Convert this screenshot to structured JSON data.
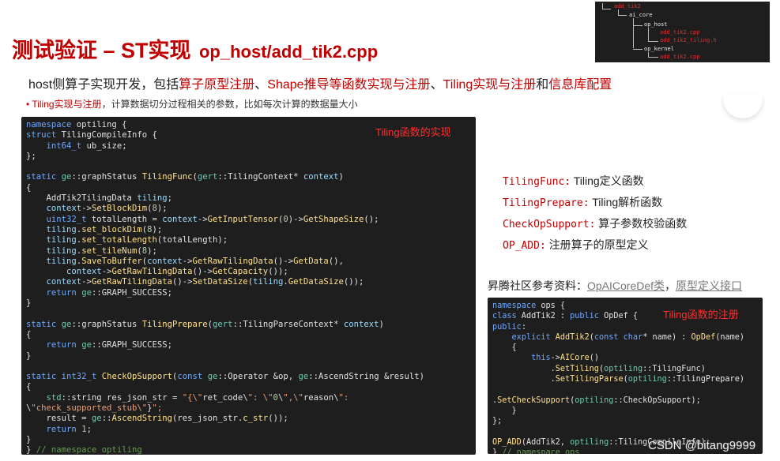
{
  "title": {
    "main": "测试验证 – ST实现",
    "path": "op_host/add_tik2.cpp"
  },
  "tree": {
    "root": "add_tik2",
    "core": "ai_core",
    "host": "op_host",
    "host_files": [
      "add_tik2.cpp",
      "add_tik2_tiling.h"
    ],
    "kernel": "op_kernel",
    "kernel_files": [
      "add_tik2.cpp"
    ]
  },
  "subtitle": {
    "prefix": "host侧算子实现开发，包括",
    "p1": "算子原型注册",
    "sep1": "、",
    "p2": "Shape推导等函数实现与注册",
    "sep2": "、",
    "p3": "Tiling实现与注册",
    "mid": "和",
    "p4": "信息库配置"
  },
  "bullet": {
    "dot": "•",
    "red": "Tiling实现与注册",
    "rest": "，计算数据切分过程相关的参数，比如每次计算的数据量大小"
  },
  "left_panel_tag": "Tiling函数的实现",
  "right_panel_tag": "Tiling函数的注册",
  "legend": [
    {
      "key": "TilingFunc:",
      "desc": "Tiling定义函数"
    },
    {
      "key": "TilingPrepare:",
      "desc": "Tiling解析函数"
    },
    {
      "key": "CheckOpSupport:",
      "desc": "算子参数校验函数"
    },
    {
      "key": "OP_ADD:",
      "desc": "注册算子的原型定义"
    }
  ],
  "refs": {
    "label": "昇腾社区参考资料：",
    "link1": "OpAICoreDef类",
    "sep": "，",
    "link2": "原型定义接口"
  },
  "watermark": "CSDN @bitang9999",
  "code_left": [
    "namespace optiling {",
    "struct TilingCompileInfo {",
    "    int64_t ub_size;",
    "};",
    "",
    "static ge::graphStatus TilingFunc(gert::TilingContext* context)",
    "{",
    "    AddTik2TilingData tiling;",
    "    context->SetBlockDim(8);",
    "    uint32_t totalLength = context->GetInputTensor(0)->GetShapeSize();",
    "    tiling.set_blockDim(8);",
    "    tiling.set_totalLength(totalLength);",
    "    tiling.set_tileNum(8);",
    "    tiling.SaveToBuffer(context->GetRawTilingData()->GetData(),",
    "        context->GetRawTilingData()->GetCapacity());",
    "    context->GetRawTilingData()->SetDataSize(tiling.GetDataSize());",
    "    return ge::GRAPH_SUCCESS;",
    "}",
    "",
    "static ge::graphStatus TilingPrepare(gert::TilingParseContext* context)",
    "{",
    "    return ge::GRAPH_SUCCESS;",
    "}",
    "",
    "static int32_t CheckOpSupport(const ge::Operator &op, ge::AscendString &result)",
    "{",
    "    std::string res_json_str = \"{\\\"ret_code\\\": \\\"0\\\",\\\"reason\\\":",
    "\\\"check_supported_stub\\\"}\";",
    "    result = ge::AscendString(res_json_str.c_str());",
    "    return 1;",
    "}",
    "} // namespace optiling"
  ],
  "code_right": [
    "namespace ops {",
    "class AddTik2 : public OpDef {",
    "public:",
    "    explicit AddTik2(const char* name) : OpDef(name)",
    "    {",
    "        this->AICore()",
    "            .SetTiling(optiling::TilingFunc)",
    "            .SetTilingParse(optiling::TilingPrepare)",
    "",
    ".SetCheckSupport(optiling::CheckOpSupport);",
    "    }",
    "};",
    "",
    "OP_ADD(AddTik2, optiling::TilingCompileInfo);",
    "} // namespace ops"
  ]
}
